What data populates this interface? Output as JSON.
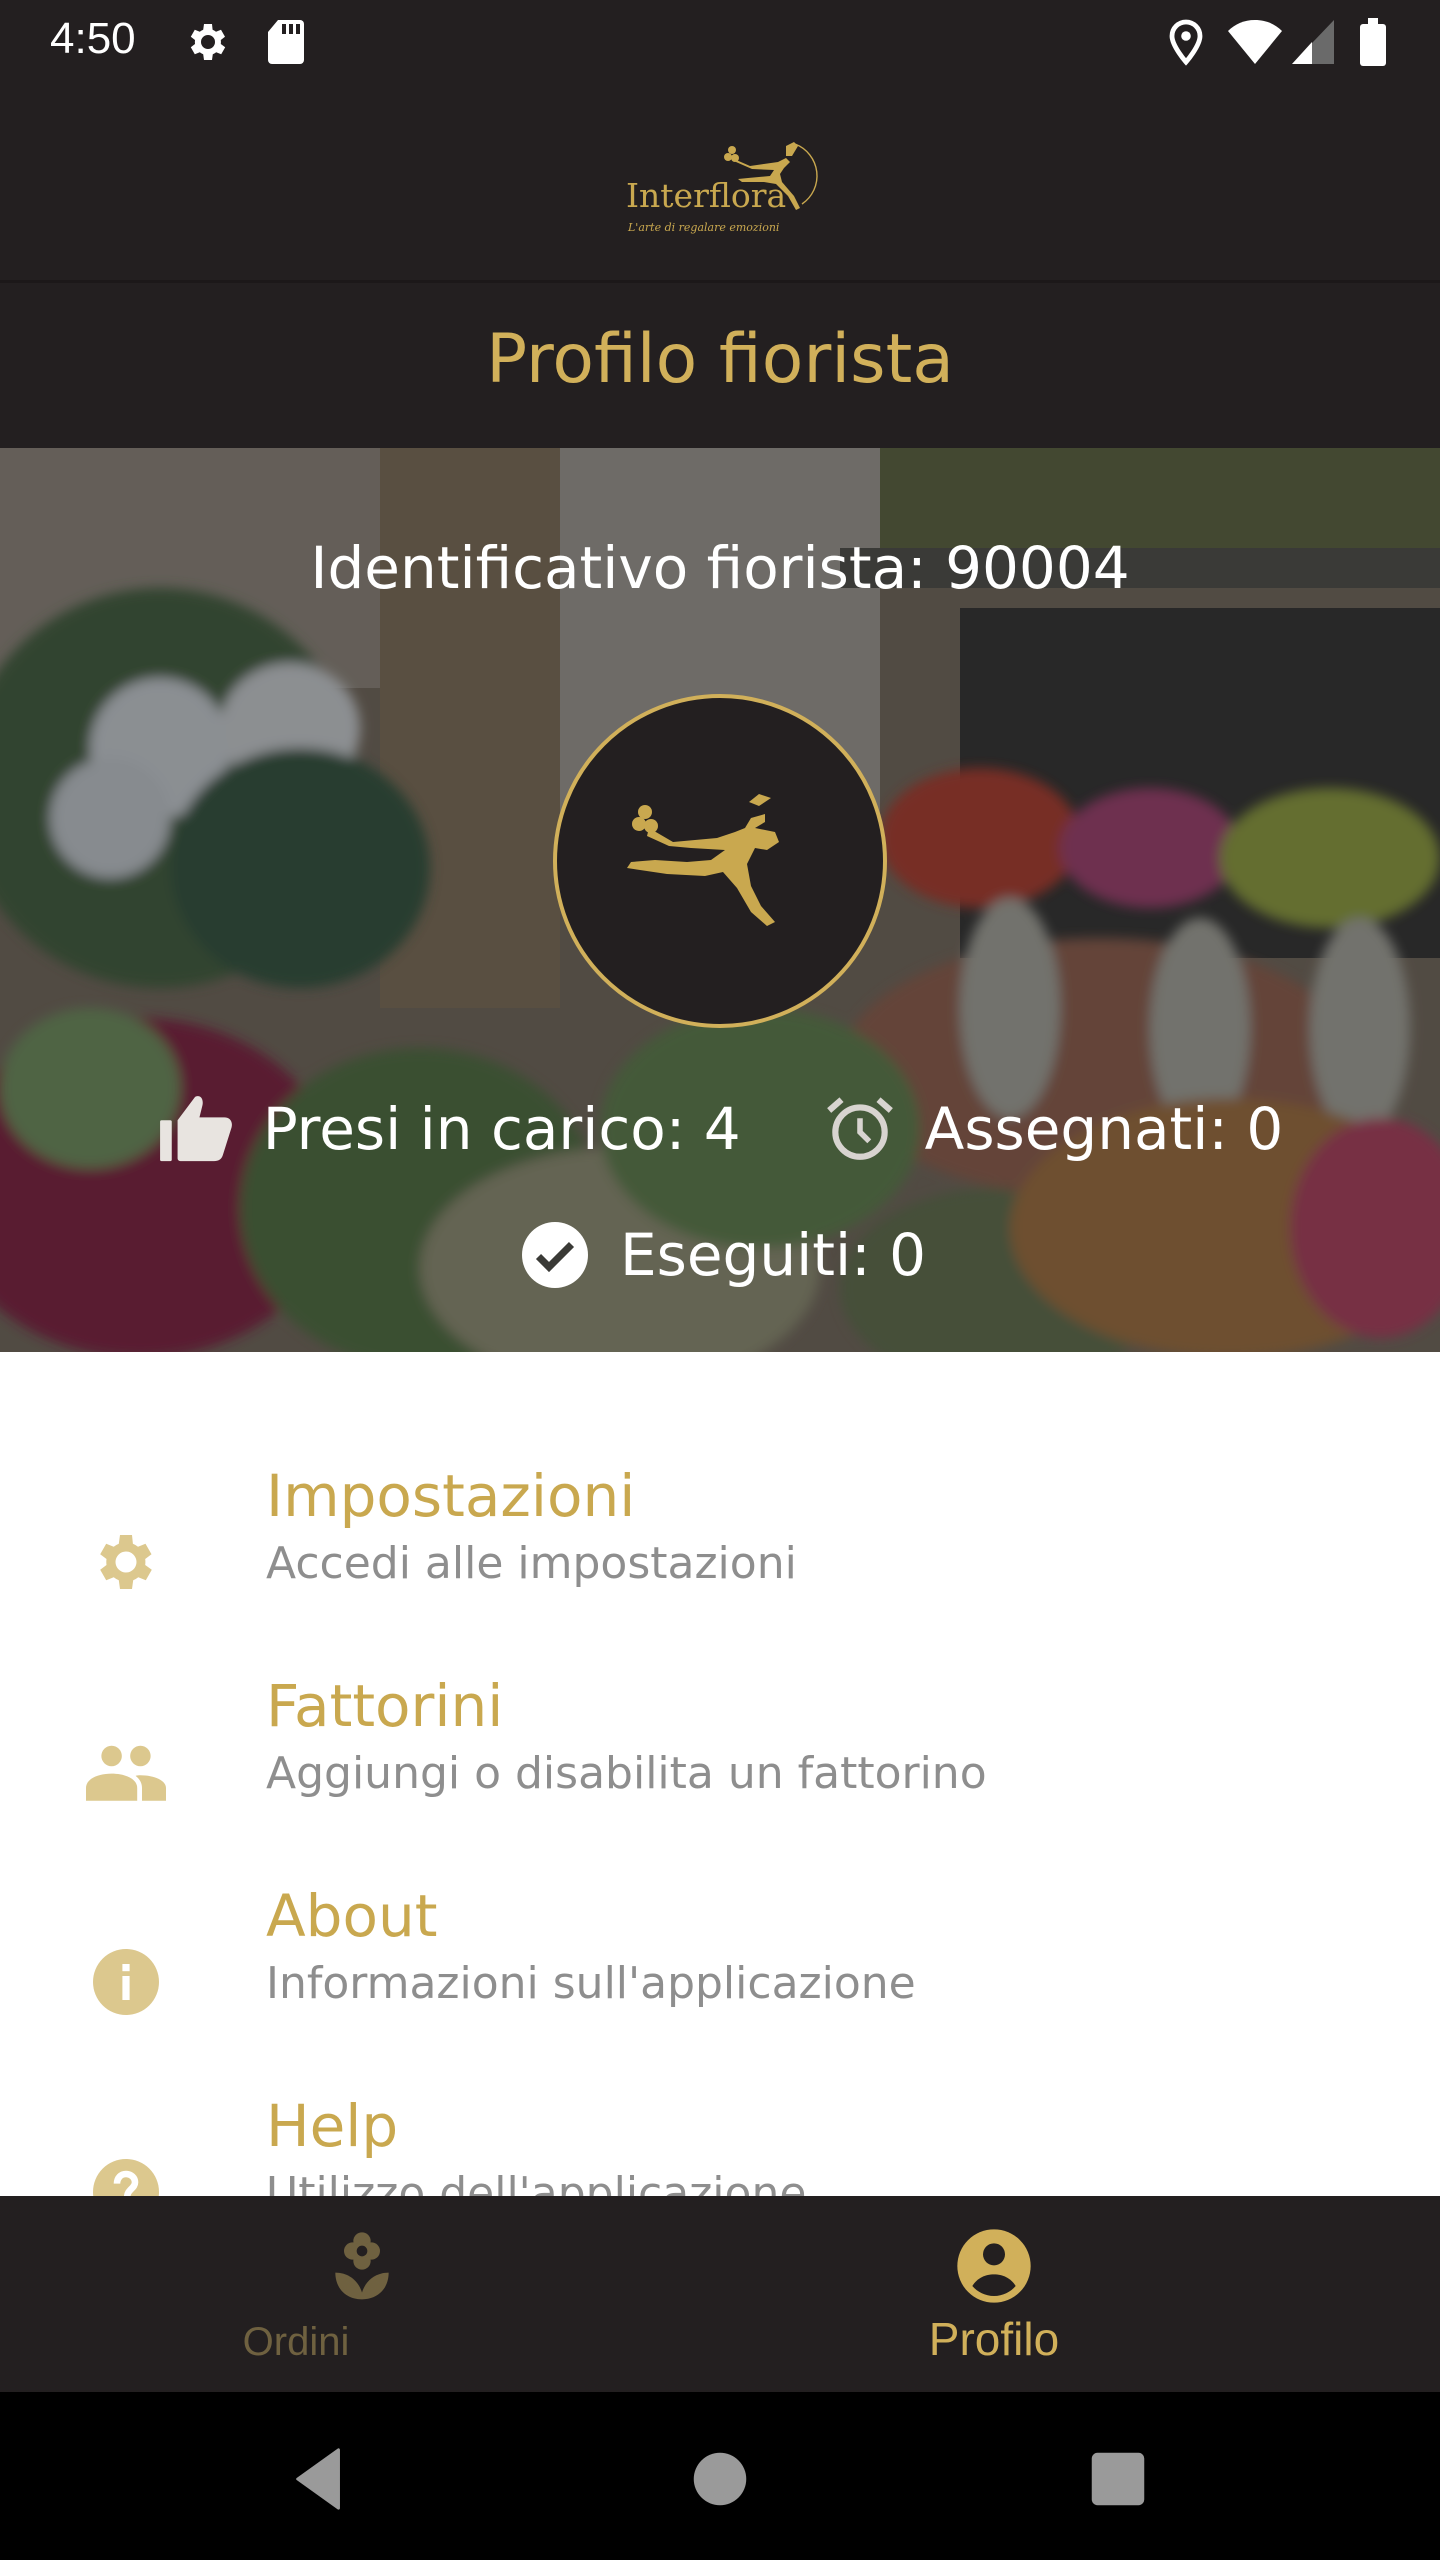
{
  "status_bar": {
    "time": "4:50",
    "left_icons": [
      "settings-gear-icon",
      "sd-card-icon"
    ],
    "right_icons": [
      "location-icon",
      "wifi-icon",
      "signal-icon",
      "battery-icon"
    ]
  },
  "header": {
    "logo_word": "Interflora",
    "logo_tagline": "L'arte di regalare emozioni",
    "title": "Profilo fiorista"
  },
  "hero": {
    "florist_id_label": "Identificativo fiorista: 90004",
    "stats": [
      {
        "icon": "thumbs-up-icon",
        "label": "Presi in carico: 4"
      },
      {
        "icon": "alarm-clock-icon",
        "label": "Assegnati: 0"
      },
      {
        "icon": "check-circle-icon",
        "label": "Eseguiti: 0"
      }
    ]
  },
  "menu": {
    "items": [
      {
        "icon": "settings-icon",
        "title": "Impostazioni",
        "subtitle": "Accedi alle impostazioni"
      },
      {
        "icon": "people-icon",
        "title": "Fattorini",
        "subtitle": "Aggiungi o disabilita un fattorino"
      },
      {
        "icon": "info-icon",
        "title": "About",
        "subtitle": "Informazioni sull'applicazione"
      },
      {
        "icon": "help-icon",
        "title": "Help",
        "subtitle": "Utilizzo dell'applicazione"
      }
    ]
  },
  "bottom_nav": {
    "tabs": [
      {
        "icon": "flower-icon",
        "label": "Ordini",
        "active": false
      },
      {
        "icon": "account-circle-icon",
        "label": "Profilo",
        "active": true
      }
    ]
  },
  "colors": {
    "dark_bg": "#231f20",
    "gold": "#d1b05a",
    "gold_icon": "#dcc88e",
    "subtitle_gray": "#8e8e8e"
  }
}
